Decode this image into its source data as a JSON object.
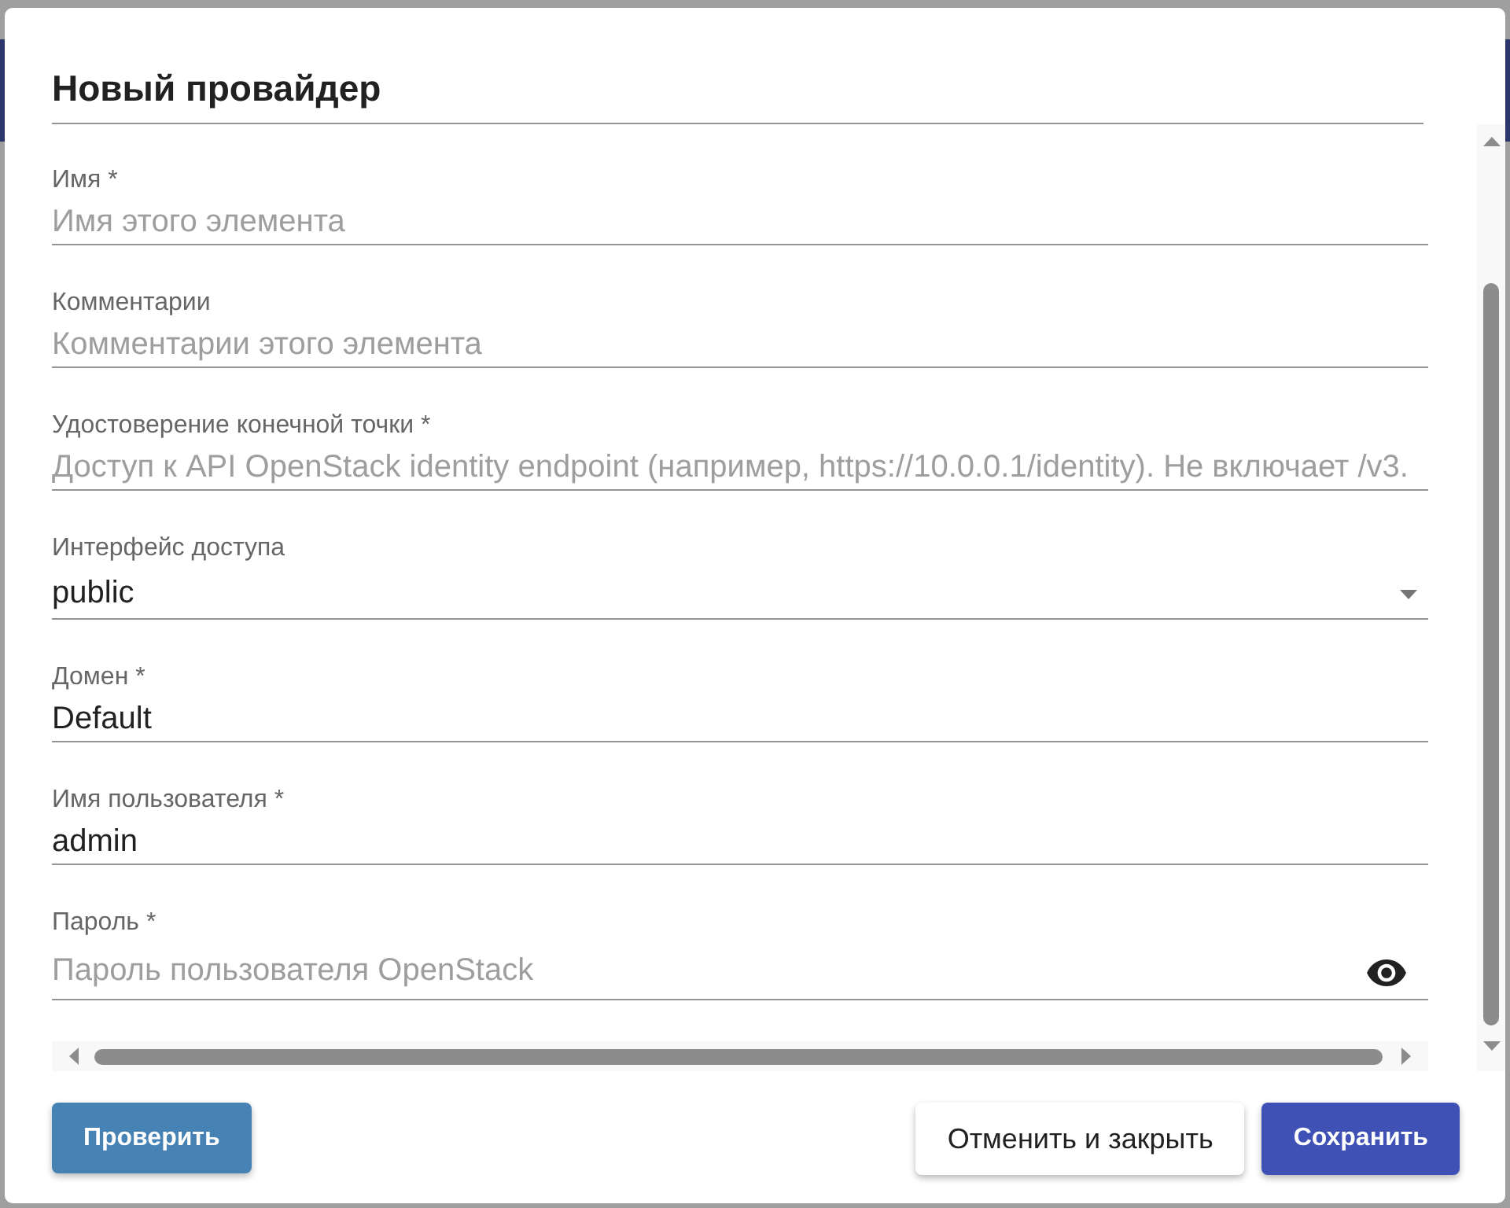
{
  "dialog": {
    "title": "Новый провайдер"
  },
  "fields": [
    {
      "kind": "text",
      "label": "Имя *",
      "placeholder": "Имя этого элемента"
    },
    {
      "kind": "text",
      "label": "Комментарии",
      "placeholder": "Комментарии этого элемента"
    },
    {
      "kind": "text",
      "label": "Удостоверение конечной точки *",
      "placeholder": "Доступ к API OpenStack identity endpoint (например, https://10.0.0.1/identity). Не включает /v3."
    },
    {
      "kind": "select",
      "label": "Интерфейс доступа",
      "value": "public"
    },
    {
      "kind": "text",
      "label": "Домен *",
      "value": "Default"
    },
    {
      "kind": "text",
      "label": "Имя пользователя *",
      "value": "admin"
    },
    {
      "kind": "password",
      "label": "Пароль *",
      "placeholder": "Пароль пользователя OpenStack"
    }
  ],
  "actions": {
    "start": [
      {
        "kind": "test",
        "label": "Проверить"
      }
    ],
    "end": [
      {
        "kind": "cancel",
        "label": "Отменить и закрыть"
      },
      {
        "kind": "primary",
        "label": "Сохранить"
      }
    ]
  }
}
